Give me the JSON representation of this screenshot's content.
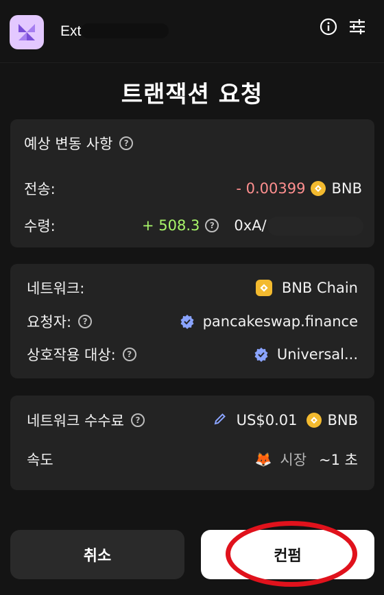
{
  "header": {
    "app_name": "Ext",
    "info_icon": "info-icon",
    "settings_icon": "sliders-icon"
  },
  "title": "트랜잭션 요청",
  "estimated_changes": {
    "heading": "예상 변동 사항",
    "send_label": "전송:",
    "send_amount": "- 0.00399",
    "send_token": "BNB",
    "receive_label": "수령:",
    "receive_amount": "+ 508.3",
    "receive_address": "0xA/"
  },
  "details": {
    "network_label": "네트워크:",
    "network_value": "BNB Chain",
    "requester_label": "요청자:",
    "requester_value": "pancakeswap.finance",
    "interacting_label": "상호작용 대상:",
    "interacting_value": "Universal..."
  },
  "fee": {
    "label": "네트워크 수수료",
    "amount": "US$0.01",
    "token": "BNB",
    "speed_label": "속도",
    "speed_value": "시장",
    "speed_time": "~1 초"
  },
  "buttons": {
    "cancel": "취소",
    "confirm": "컨펌"
  },
  "colors": {
    "negative": "#ff8f8f",
    "positive": "#a8f56a",
    "bnb": "#f3ba2f",
    "verified": "#8aa4ff",
    "annotation": "#e0121c"
  }
}
